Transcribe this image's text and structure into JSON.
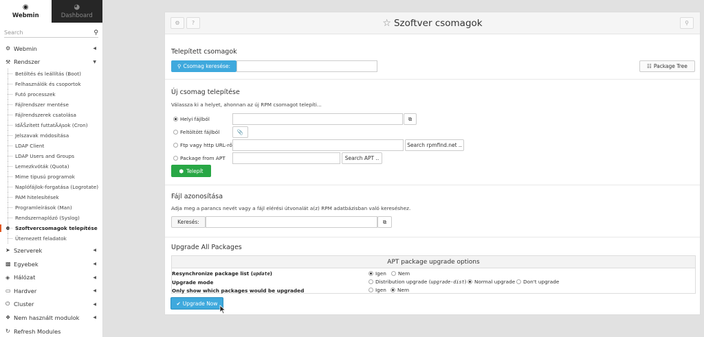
{
  "sidebar": {
    "tab_webmin": "Webmin",
    "tab_dashboard": "Dashboard",
    "search_placeholder": "Search",
    "cats": [
      {
        "label": "Webmin"
      },
      {
        "label": "Rendszer"
      },
      {
        "label": "Szerverek"
      },
      {
        "label": "Egyebek"
      },
      {
        "label": "Hálózat"
      },
      {
        "label": "Hardver"
      },
      {
        "label": "Cluster"
      },
      {
        "label": "Nem használt modulok"
      },
      {
        "label": "Refresh Modules"
      }
    ],
    "items": [
      "Betöltés és leállítás (Boot)",
      "Felhasználók és csoportok",
      "Futó processzek",
      "Fájlrendszer mentése",
      "Fájlrendszerek csatolása",
      "IdĂŠzített futtatĂĄsok (Cron)",
      "Jelszavak módosítása",
      "LDAP Client",
      "LDAP Users and Groups",
      "Lemezkvóták (Quota)",
      "Mime tipusú programok",
      "Naplófájlok-forgatása (Logrotate)",
      "PAM hitelesítések",
      "Programleírások (Man)",
      "Rendszernaplózó (Syslog)",
      "Szoftvercsomagok telepítése",
      "Ütemezett feladatok"
    ]
  },
  "panel": {
    "title": "Szoftver csomagok",
    "installed": {
      "heading": "Telepített csomagok",
      "search_button": "Csomag keresése:",
      "tree_button": "Package Tree"
    },
    "new_pkg": {
      "heading": "Új csomag telepítése",
      "desc": "Válassza ki a helyet, ahonnan az új RPM csomagot telepíti...",
      "opt_local": "Helyi fájlból",
      "opt_upload": "Feltöltött fájlból",
      "opt_url": "Ftp vagy http URL-ről",
      "opt_apt": "Package from APT",
      "rpmfind_button": "Search rpmfind.net ..",
      "apt_button": "Search APT ..",
      "install_button": "Telepít"
    },
    "file_id": {
      "heading": "Fájl azonosítása",
      "desc": "Adja meg a parancs nevét vagy a fájl elérési útvonalát a(z) RPM adatbázisban való kereséshez.",
      "search_label": "Keresés:"
    },
    "upgrade": {
      "heading": "Upgrade All Packages",
      "table_title": "APT package upgrade options",
      "resync_label": "Resynchronize package list (",
      "resync_code": "update",
      "resync_close": ")",
      "mode_label": "Upgrade mode",
      "only_show_label": "Only show which packages would be upgraded",
      "yes": "Igen",
      "no": "Nem",
      "dist_label": "Distribution upgrade (",
      "dist_code": "upgrade-dist",
      "dist_close": ")",
      "normal": "Normal upgrade",
      "dont": "Don't upgrade",
      "button": "Upgrade Now"
    }
  }
}
